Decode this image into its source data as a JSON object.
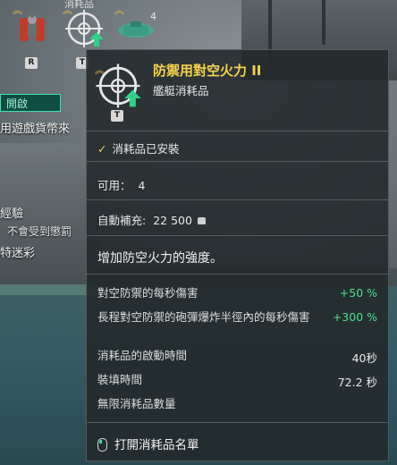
{
  "slots_bar": {
    "header_label": "消耗品",
    "slots": [
      {
        "icon": "fire-extinguisher-icon",
        "key": "R"
      },
      {
        "icon": "aa-defense-icon",
        "key": "T"
      },
      {
        "icon": "spotter-plane-icon",
        "count": "4"
      }
    ]
  },
  "left_panel": {
    "open_button": "開啟",
    "line1": "用遊戲貨幣來",
    "line2": "經驗",
    "line3": "不會受到懲罰",
    "line4": "特迷彩"
  },
  "tooltip": {
    "title": "防禦用對空火力 II",
    "subtitle": "艦艇消耗品",
    "key": "T",
    "installed": "消耗品已安裝",
    "charges_label": "可用：",
    "charges_value": "4",
    "autobuy_label": "自動補充:",
    "autobuy_value": "22 500",
    "description": "增加防空火力的強度。",
    "stats": [
      {
        "label": "對空防禦的每秒傷害",
        "value": "+50 %"
      },
      {
        "label": "長程對空防禦的砲彈爆炸半徑內的每秒傷害",
        "value": "+300 %"
      },
      {
        "label": "消耗品的啟動時間",
        "value": "40秒"
      },
      {
        "label": "裝填時間",
        "value": "72.2 秒"
      },
      {
        "label": "無限消耗品數量",
        "value": ""
      }
    ],
    "footer_action": "打開消耗品名單"
  },
  "colors": {
    "title_yellow": "#f4d24a",
    "bonus_green": "#4ee28f",
    "accent_teal": "#3ee0b0"
  }
}
